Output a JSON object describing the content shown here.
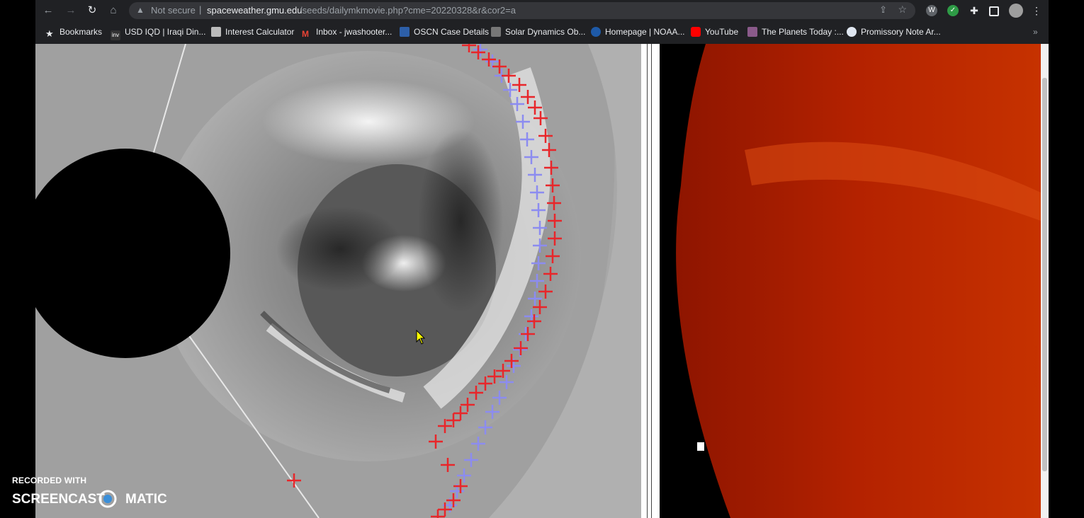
{
  "browser": {
    "url_warning": "Not secure",
    "url_host": "spaceweather.gmu.edu",
    "url_path": "/seeds/dailymkmovie.php?cme=20220328&r&cor2=a",
    "bookmarks": [
      {
        "label": "Bookmarks",
        "icon": "star-icon"
      },
      {
        "label": "USD IQD | Iraqi Din...",
        "icon": "investing-icon"
      },
      {
        "label": "Interest Calculator",
        "icon": "calculator-icon"
      },
      {
        "label": "Inbox - jwashooter...",
        "icon": "gmail-icon"
      },
      {
        "label": "OSCN Case Details",
        "icon": "oscn-icon"
      },
      {
        "label": "Solar Dynamics Ob...",
        "icon": "sdo-icon"
      },
      {
        "label": "Homepage | NOAA...",
        "icon": "noaa-icon"
      },
      {
        "label": "YouTube",
        "icon": "youtube-icon"
      },
      {
        "label": "The Planets Today :...",
        "icon": "planets-icon"
      },
      {
        "label": "Promissory Note Ar...",
        "icon": "document-icon"
      }
    ],
    "overflow": "»"
  },
  "watermark": {
    "recorded_with": "RECORDED WITH",
    "brand_left": "SCREENCAST",
    "brand_right": "MATIC"
  },
  "colors": {
    "track_red": "#e8262a",
    "track_blue": "#8c8cf0",
    "occulter": "#000000"
  }
}
